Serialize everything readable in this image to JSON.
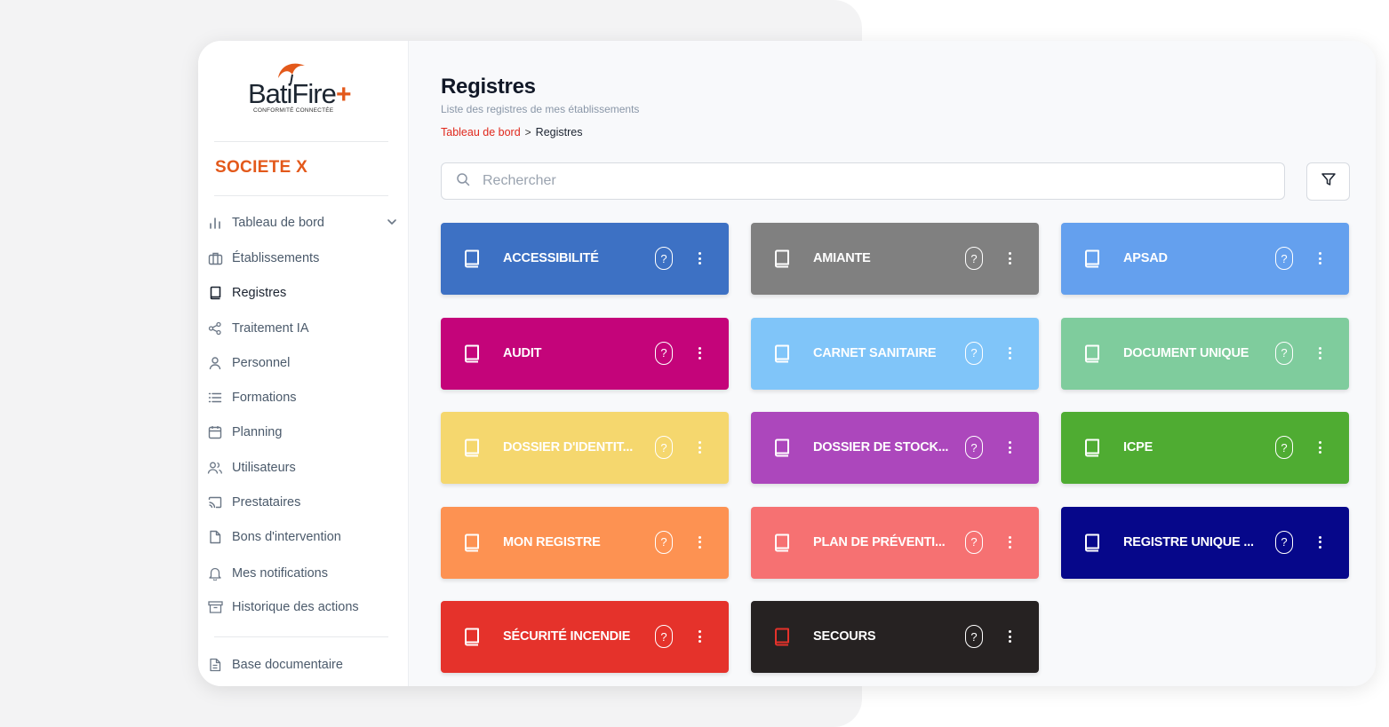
{
  "brand": {
    "logo_text": "BatiFire",
    "logo_tagline": "CONFORMITÉ CONNECTÉE",
    "company": "SOCIETE X",
    "accent": "#e3591b"
  },
  "sidebar": {
    "items": [
      {
        "label": "Tableau de bord",
        "icon": "bar-chart-icon",
        "active": false,
        "has_chevron": true
      },
      {
        "label": "Établissements",
        "icon": "briefcase-icon",
        "active": false
      },
      {
        "label": "Registres",
        "icon": "book-icon",
        "active": true
      },
      {
        "label": "Traitement IA",
        "icon": "share-nodes-icon",
        "active": false
      },
      {
        "label": "Personnel",
        "icon": "user-icon",
        "active": false
      },
      {
        "label": "Formations",
        "icon": "list-icon",
        "active": false
      },
      {
        "label": "Planning",
        "icon": "calendar-icon",
        "active": false
      },
      {
        "label": "Utilisateurs",
        "icon": "users-icon",
        "active": false
      },
      {
        "label": "Prestataires",
        "icon": "cast-icon",
        "active": false
      },
      {
        "label": "Bons d'intervention",
        "icon": "file-icon",
        "active": false
      },
      {
        "label": "Mes notifications",
        "icon": "bell-icon",
        "active": false
      },
      {
        "label": "Historique des actions",
        "icon": "archive-icon",
        "active": false
      }
    ],
    "bottom_item": {
      "label": "Base documentaire",
      "icon": "document-icon"
    }
  },
  "page": {
    "title": "Registres",
    "subtitle": "Liste des registres de mes établissements",
    "breadcrumb": {
      "link": "Tableau de bord",
      "separator": ">",
      "current": "Registres"
    }
  },
  "search": {
    "placeholder": "Rechercher",
    "value": ""
  },
  "registers": [
    {
      "name": "ACCESSIBILITÉ",
      "color": "#3d71c4",
      "book_color": "#ffffff"
    },
    {
      "name": "AMIANTE",
      "color": "#808080",
      "book_color": "#ffffff"
    },
    {
      "name": "APSAD",
      "color": "#64a0ee",
      "book_color": "#ffffff"
    },
    {
      "name": "AUDIT",
      "color": "#c4047a",
      "book_color": "#ffffff"
    },
    {
      "name": "CARNET SANITAIRE",
      "color": "#80c5f9",
      "book_color": "#ffffff"
    },
    {
      "name": "DOCUMENT UNIQUE",
      "color": "#7fcc9d",
      "book_color": "#ffffff"
    },
    {
      "name": "DOSSIER D'IDENTIT...",
      "color": "#f5d76e",
      "book_color": "#ffffff"
    },
    {
      "name": "DOSSIER DE STOCK...",
      "color": "#ac47bc",
      "book_color": "#ffffff"
    },
    {
      "name": "ICPE",
      "color": "#4fac32",
      "book_color": "#ffffff"
    },
    {
      "name": "MON REGISTRE",
      "color": "#fd9252",
      "book_color": "#ffffff"
    },
    {
      "name": "PLAN DE PRÉVENTI...",
      "color": "#f67172",
      "book_color": "#ffffff"
    },
    {
      "name": "REGISTRE UNIQUE ...",
      "color": "#06078a",
      "book_color": "#ffffff"
    },
    {
      "name": "SÉCURITÉ INCENDIE",
      "color": "#e5322b",
      "book_color": "#ffffff"
    },
    {
      "name": "SECOURS",
      "color": "#262222",
      "book_color": "#e5322b"
    }
  ]
}
